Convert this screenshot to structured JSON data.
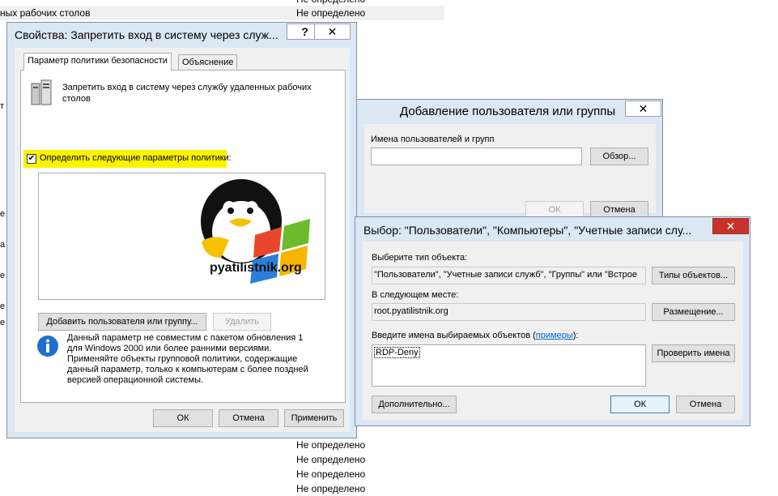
{
  "background": {
    "top_row_name": "ных рабочих столов",
    "not_defined": "Не определено",
    "edge_fragments": [
      "т",
      "е",
      "а",
      "е",
      "е",
      "е"
    ]
  },
  "policy_window": {
    "title": "Свойства: Запретить вход в систему через служ...",
    "help_label": "?",
    "close_label": "✕",
    "tabs": [
      "Параметр политики безопасности",
      "Объяснение"
    ],
    "policy_name": "Запретить вход в систему через службу удаленных рабочих столов",
    "define_checkbox_label": "Определить следующие параметры политики:",
    "logo_text": "pyatilistnik.org",
    "add_button": "Добавить пользователя или группу...",
    "remove_button": "Удалить",
    "info_text": "Данный параметр не совместим с пакетом обновления 1 для Windows 2000 или более ранними версиями. Применяйте объекты групповой политики, содержащие данный параметр, только к компьютерам с более поздней версией операционной системы.",
    "ok_button": "ОК",
    "cancel_button": "Отмена",
    "apply_button": "Применить"
  },
  "add_user_window": {
    "title": "Добавление пользователя или группы",
    "close_label": "✕",
    "names_label": "Имена пользователей и групп",
    "names_value": "",
    "browse_button": "Обзор...",
    "ok_button": "ОК",
    "cancel_button": "Отмена"
  },
  "select_window": {
    "title": "Выбор: \"Пользователи\", \"Компьютеры\", \"Учетные записи слу...",
    "close_label": "✕",
    "object_type_label": "Выберите тип объекта:",
    "object_type_value": "\"Пользователи\", \"Учетные записи служб\", \"Группы\" или \"Встрое",
    "object_types_button": "Типы объектов...",
    "location_label": "В следующем месте:",
    "location_value": "root.pyatilistnik.org",
    "locations_button": "Размещение...",
    "enter_names_label_pre": "Введите имена выбираемых объектов (",
    "enter_names_link": "примеры",
    "enter_names_label_post": "):",
    "entered_name": "RDP-Deny",
    "check_names_button": "Проверить имена",
    "advanced_button": "Дополнительно...",
    "ok_button": "ОК",
    "cancel_button": "Отмена"
  }
}
